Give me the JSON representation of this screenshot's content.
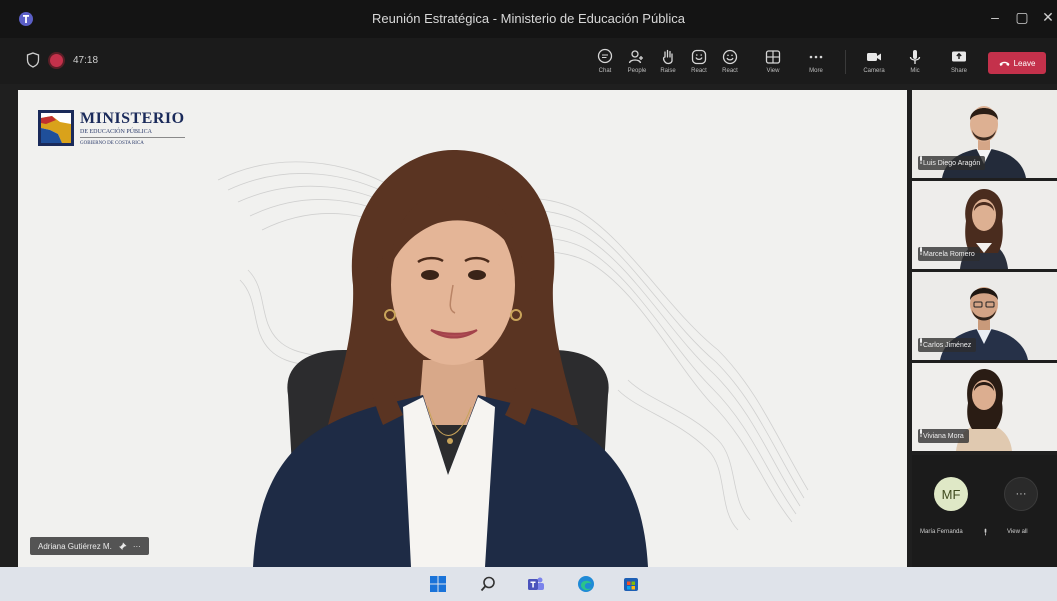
{
  "window": {
    "title": "Reunión Estratégica - Ministerio de Educación Pública"
  },
  "toolbar": {
    "timer": "47:18",
    "buttons": [
      {
        "label": "Chat",
        "icon": "chat-icon"
      },
      {
        "label": "People",
        "icon": "people-icon"
      },
      {
        "label": "Raise",
        "icon": "raise-hand-icon"
      },
      {
        "label": "React",
        "icon": "react-icon"
      },
      {
        "label": "React",
        "icon": "smiley-icon"
      },
      {
        "label": "View",
        "icon": "view-grid-icon"
      },
      {
        "label": "More",
        "icon": "more-icon"
      },
      {
        "label": "Camera",
        "icon": "camera-icon"
      },
      {
        "label": "Mic",
        "icon": "mic-icon"
      },
      {
        "label": "Share",
        "icon": "share-icon"
      }
    ],
    "leave_label": "Leave"
  },
  "stage": {
    "logo": {
      "line1": "MINISTERIO",
      "line2": "DE EDUCACIÓN PÚBLICA",
      "line3": "GOBIERNO DE COSTA RICA"
    },
    "speaker_name": "Adriana Gutiérrez M."
  },
  "participants": [
    {
      "name": "Luis Diego Aragón"
    },
    {
      "name": "Marcela Romero"
    },
    {
      "name": "Carlos Jiménez"
    },
    {
      "name": "Viviana Mora"
    }
  ],
  "bottom": {
    "avatar_initials": "MF",
    "avatar_name": "María Fernanda",
    "view_all_label": "View all",
    "view_all_glyph": "···"
  },
  "colors": {
    "leave": "#c4314b",
    "accent": "#6264a7"
  }
}
